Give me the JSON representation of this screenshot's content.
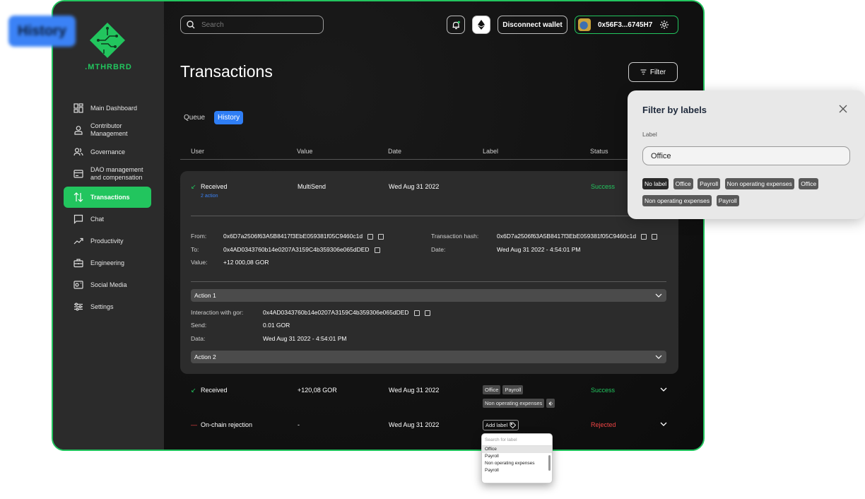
{
  "floating_tag": "History",
  "brand": {
    "name": ".MTHRBRD",
    "accent": "#22c55e"
  },
  "sidebar": {
    "items": [
      {
        "label": "Main Dashboard",
        "icon": "dashboard-icon",
        "active": false
      },
      {
        "label": "Contributor Management",
        "icon": "person-icon",
        "active": false
      },
      {
        "label": "Governance",
        "icon": "people-icon",
        "active": false
      },
      {
        "label": "DAO management and compensation",
        "icon": "card-icon",
        "active": false
      },
      {
        "label": "Transactions",
        "icon": "swap-arrows-icon",
        "active": true
      },
      {
        "label": "Chat",
        "icon": "chat-icon",
        "active": false
      },
      {
        "label": "Productivity",
        "icon": "trend-icon",
        "active": false
      },
      {
        "label": "Engineering",
        "icon": "briefcase-icon",
        "active": false
      },
      {
        "label": "Social Media",
        "icon": "photo-icon",
        "active": false
      },
      {
        "label": "Settings",
        "icon": "sliders-icon",
        "active": false
      }
    ]
  },
  "header": {
    "search_placeholder": "Search",
    "disconnect_label": "Disconnect wallet",
    "wallet_address": "0x56F3...6745H7"
  },
  "page": {
    "title": "Transactions",
    "filter_label": "Filter"
  },
  "tabs": [
    {
      "label": "Queue",
      "active": false
    },
    {
      "label": "History",
      "active": true
    }
  ],
  "table": {
    "columns": [
      "User",
      "Value",
      "Date",
      "Label",
      "Status"
    ],
    "expanded": {
      "user": "Received",
      "sub": "2 action",
      "value": "MultiSend",
      "date": "Wed Aug 31 2022",
      "status": "Success",
      "from_label": "From:",
      "from": "0x6D7a2506f63A5B8417f3EbE059381f05C9460c1d",
      "to_label": "To:",
      "to": "0x4AD0343760b14e0207A3159C4b359306e065dDED",
      "value_label": "Value:",
      "amount": "+12 000,08 GOR",
      "hash_label": "Transaction hash:",
      "hash": "0x6D7a2506f63A5B8417f3EbE059381f05C9460c1d",
      "date_label": "Date:",
      "datetime": "Wed Aug 31 2022 - 4:54:01 PM",
      "action1": "Action 1",
      "interaction_label": "Interaction with gor:",
      "interaction": "0x4AD0343760b14e0207A3159C4b359306e065dDED",
      "send_label": "Send:",
      "send": "0.01 GOR",
      "data_label": "Data:",
      "data": "Wed Aug 31 2022 - 4:54:01 PM",
      "action2": "Action 2"
    },
    "rows": [
      {
        "user": "Received",
        "value": "+120,08 GOR",
        "date": "Wed Aug 31 2022",
        "labels": [
          "Office",
          "Payroll",
          "Non operating expenses"
        ],
        "status": "Success"
      },
      {
        "user": "On-chain rejection",
        "value": "-",
        "date": "Wed Aug 31 2022",
        "add_label": "Add label",
        "status": "Rejected"
      }
    ]
  },
  "label_dropdown": {
    "placeholder": "Search for label",
    "options": [
      "Office",
      "Payroll",
      "Non operating expenses",
      "Payroll"
    ]
  },
  "filter_panel": {
    "title": "Filter by labels",
    "field_label": "Label",
    "field_value": "Office",
    "chips": [
      "No label",
      "Office",
      "Payroll",
      "Non operating expenses",
      "Office",
      "Non operating expenses",
      "Payroll"
    ]
  }
}
